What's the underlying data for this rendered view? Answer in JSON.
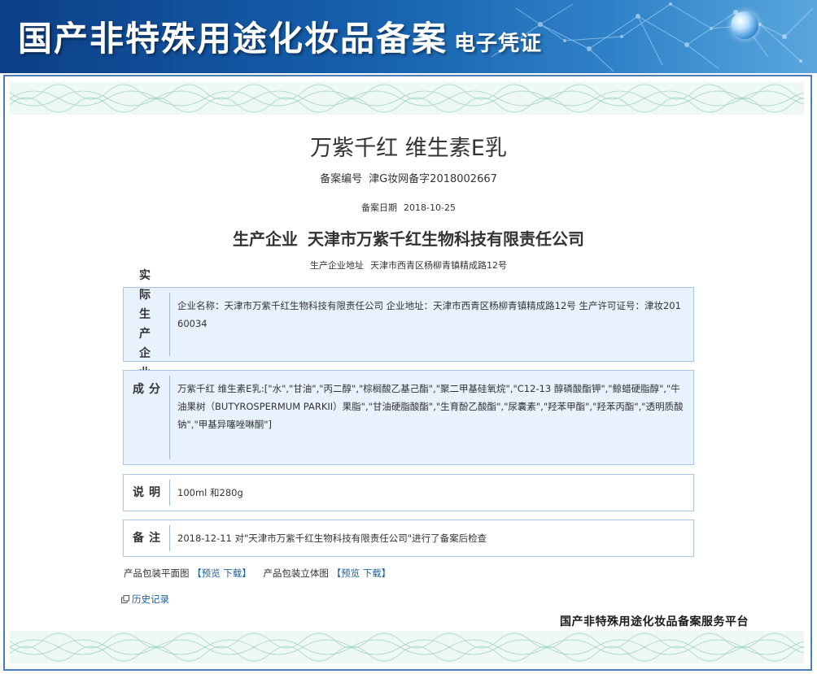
{
  "header": {
    "title": "国产非特殊用途化妆品备案",
    "subtitle": "电子凭证"
  },
  "product": {
    "name": "万紫千红 维生素E乳",
    "record_no_label": "备案编号",
    "record_no": "津G妆网备字2018002667",
    "record_date_label": "备案日期",
    "record_date": "2018-10-25",
    "manufacturer_label": "生产企业",
    "manufacturer": "天津市万紫千红生物科技有限责任公司",
    "address_label": "生产企业地址",
    "address": "天津市西青区杨柳青镇精成路12号"
  },
  "sections": [
    {
      "label": "实际生产企业",
      "text": "企业名称：天津市万紫千红生物科技有限责任公司 企业地址：天津市西青区杨柳青镇精成路12号 生产许可证号：津妆20160034"
    },
    {
      "label": "成分",
      "text": "万紫千红 维生素E乳:[\"水\",\"甘油\",\"丙二醇\",\"棕榈酸乙基己酯\",\"聚二甲基硅氧烷\",\"C12-13 醇磷酸酯钾\",\"鲸蜡硬脂醇\",\"牛油果树（BUTYROSPERMUM PARKII）果脂\",\"甘油硬脂酸酯\",\"生育酚乙酸酯\",\"尿囊素\",\"羟苯甲酯\",\"羟苯丙酯\",\"透明质酸钠\",\"甲基异噻唑啉酮\"]"
    },
    {
      "label": "说明",
      "text": "100ml 和280g"
    },
    {
      "label": "备注",
      "text": "2018-12-11 对\"天津市万紫千红生物科技有限责任公司\"进行了备案后检查"
    }
  ],
  "packaging": {
    "flat_label": "产品包装平面图",
    "solid_label": "产品包装立体图",
    "bracket_open": "【",
    "bracket_close": "】",
    "preview": "预览",
    "download": "下载"
  },
  "history": {
    "label": "历史记录",
    "icon": "external-window-icon"
  },
  "footer": {
    "platform": "国产非特殊用途化妆品备案服务平台"
  },
  "colors": {
    "banner_dark": "#0c3f86",
    "banner_light": "#5aa7de",
    "frame_border": "#4d7bb8",
    "box_blue_bg": "#e7f2fd",
    "box_border": "#a9c7e3",
    "link": "#1a5f9e"
  }
}
